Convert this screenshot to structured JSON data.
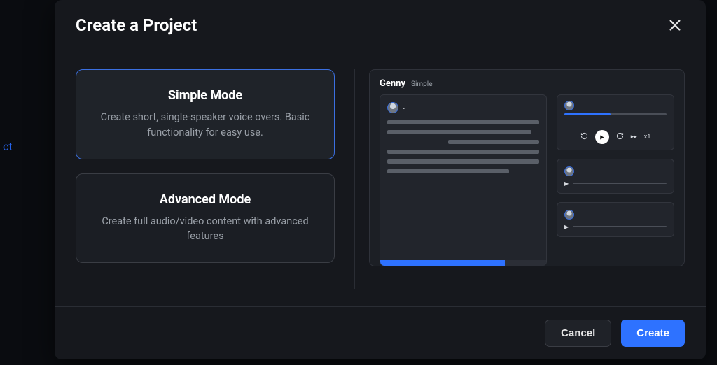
{
  "modal": {
    "title": "Create a Project",
    "options": {
      "simple": {
        "title": "Simple Mode",
        "desc": "Create short, single-speaker voice overs. Basic functionality for easy use."
      },
      "advanced": {
        "title": "Advanced Mode",
        "desc": "Create full audio/video content with advanced features"
      }
    },
    "preview": {
      "brand": "Genny",
      "mode_label": "Simple",
      "speed": "x1"
    },
    "footer": {
      "cancel": "Cancel",
      "create": "Create"
    }
  },
  "background": {
    "partial_text": "ct"
  }
}
